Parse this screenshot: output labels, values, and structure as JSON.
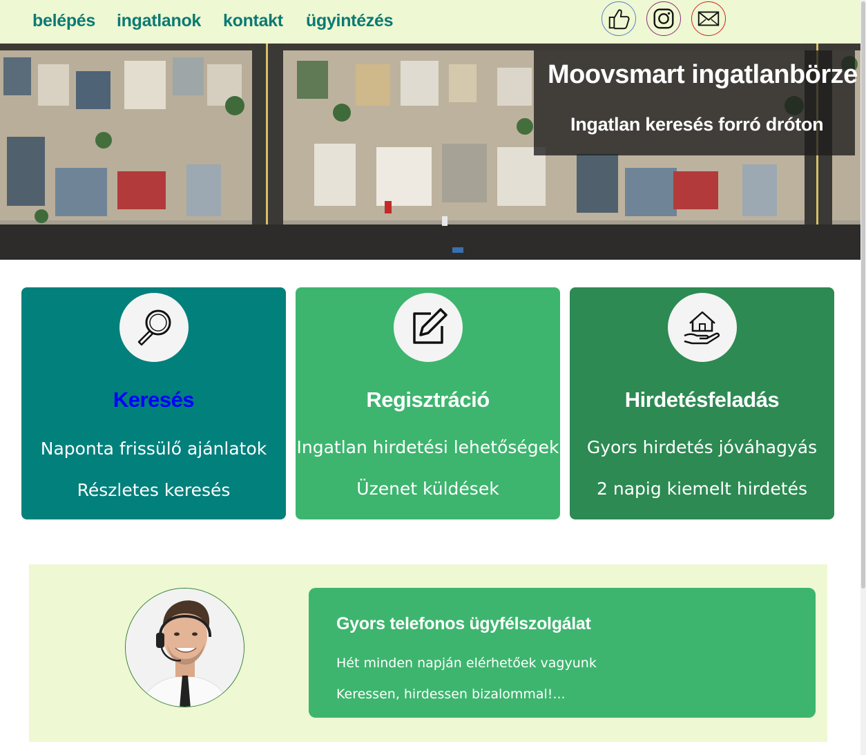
{
  "nav": {
    "links": [
      "belépés",
      "ingatlanok",
      "kontakt",
      "ügyintézés"
    ],
    "social": [
      "thumbs-up-icon",
      "instagram-icon",
      "mail-icon"
    ]
  },
  "hero": {
    "title": "Moovsmart ingatlanbörze",
    "subtitle": "Ingatlan keresés forró dróton"
  },
  "cards": [
    {
      "icon": "magnifier-icon",
      "title": "Keresés",
      "lines": [
        "Naponta frissülő ajánlatok",
        "Részletes keresés"
      ],
      "bg": "#02807c",
      "title_color": "#0000ff"
    },
    {
      "icon": "edit-icon",
      "title": "Regisztráció",
      "lines": [
        "Ingatlan hirdetési lehetőségek",
        "Üzenet küldések"
      ],
      "bg": "#3db56e",
      "title_color": "#ffffff"
    },
    {
      "icon": "house-in-hand-icon",
      "title": "Hirdetésfeladás",
      "lines": [
        "Gyors hirdetés jóváhagyás",
        "2 napig kiemelt hirdetés"
      ],
      "bg": "#2c8a52",
      "title_color": "#ffffff"
    }
  ],
  "support": {
    "title": "Gyors telefonos ügyfélszolgálat",
    "lines": [
      "Hét minden napján elérhetőek vagyunk",
      "Keressen, hirdessen bizalommal!..."
    ]
  },
  "colors": {
    "nav_bg": "#eef8d2",
    "nav_link": "#0b7a73",
    "support_bg": "#eef8d2",
    "support_card": "#3db56e"
  }
}
